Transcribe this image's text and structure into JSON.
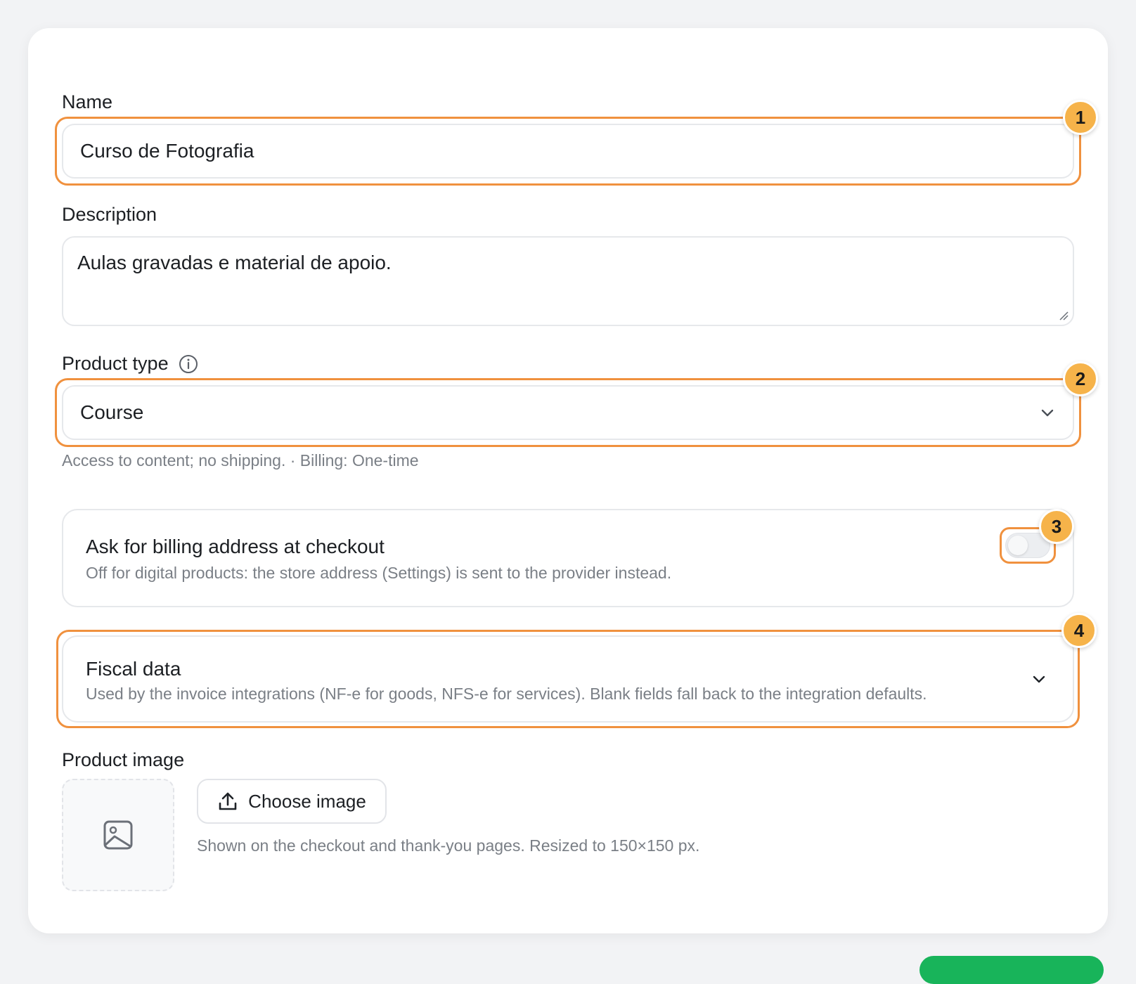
{
  "form": {
    "name_label": "Name",
    "name_value": "Curso de Fotografia",
    "description_label": "Description",
    "description_value": "Aulas gravadas e material de apoio.",
    "product_type_label": "Product type",
    "product_type_value": "Course",
    "product_type_hint": "Access to content; no shipping. · Billing: One-time",
    "billing_toggle_title": "Ask for billing address at checkout",
    "billing_toggle_sub": "Off for digital products: the store address (Settings) is sent to the provider instead.",
    "billing_toggle_on": false,
    "fiscal_title": "Fiscal data",
    "fiscal_sub": "Used by the invoice integrations (NF-e for goods, NFS-e for services). Blank fields fall back to the integration defaults.",
    "image_label": "Product image",
    "choose_image_label": "Choose image",
    "image_hint": "Shown on the checkout and thank-you pages. Resized to 150×150 px."
  },
  "badges": [
    "1",
    "2",
    "3",
    "4"
  ],
  "colors": {
    "highlight": "#f0913e",
    "badge": "#f6b34a",
    "primary_green": "#18b45a"
  },
  "icons": {
    "info": "info-icon",
    "chevron": "chevron-down-icon",
    "upload": "upload-icon",
    "image_placeholder": "image-icon"
  }
}
